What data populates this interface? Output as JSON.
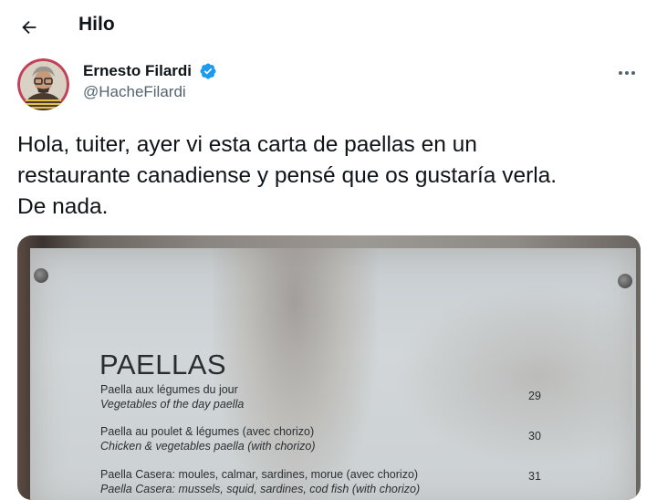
{
  "header": {
    "title": "Hilo",
    "back_icon": "arrow-left-icon"
  },
  "author": {
    "display_name": "Ernesto Filardi",
    "handle": "@HacheFilardi",
    "verified": true,
    "verified_color": "#1d9bf0"
  },
  "tweet": {
    "text": "Hola, tuiter, ayer vi esta carta de paellas en un\nrestaurante canadiense y pensé que os gustaría verla.\nDe nada."
  },
  "media": {
    "menu_title": "PAELLAS",
    "items": [
      {
        "fr": "Paella aux légumes du jour",
        "en": "Vegetables of the day paella",
        "price": "29"
      },
      {
        "fr": "Paella au poulet & légumes (avec chorizo)",
        "en": "Chicken & vegetables paella (with chorizo)",
        "price": "30"
      },
      {
        "fr": "Paella Casera: moules, calmar, sardines, morue (avec chorizo)",
        "en": "Paella Casera: mussels, squid, sardines, cod fish (with chorizo)",
        "price": "31"
      }
    ]
  },
  "colors": {
    "text": "#0f1419",
    "secondary": "#536471",
    "accent": "#1d9bf0"
  }
}
